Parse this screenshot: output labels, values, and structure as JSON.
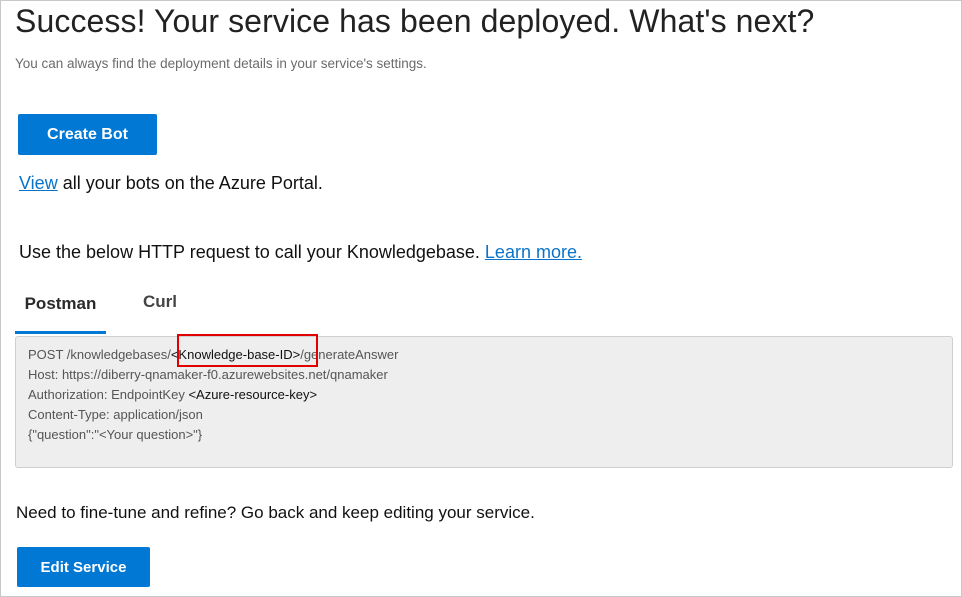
{
  "header": {
    "title": "Success! Your service has been deployed. What's next?",
    "subtitle": "You can always find the deployment details in your service's settings."
  },
  "create_bot": {
    "button_label": "Create Bot",
    "view_link": "View",
    "view_text": " all your bots on the Azure Portal."
  },
  "http_request": {
    "intro_text": "Use the below HTTP request to call your Knowledgebase. ",
    "learn_more_link": "Learn more.",
    "tabs": [
      {
        "label": "Postman",
        "selected": true
      },
      {
        "label": "Curl",
        "selected": false
      }
    ],
    "code": {
      "line1_prefix": "POST /knowledgebases/",
      "line1_placeholder": "<Knowledge-base-ID>",
      "line1_suffix": "/generateAnswer",
      "line2": "Host: https://diberry-qnamaker-f0.azurewebsites.net/qnamaker",
      "line3_prefix": "Authorization: EndpointKey ",
      "line3_placeholder": "<Azure-resource-key>",
      "line4": "Content-Type: application/json",
      "line5": "{\"question\":\"<Your question>\"}"
    },
    "highlight_color": "#e00000"
  },
  "edit": {
    "prompt_text": "Need to fine-tune and refine? Go back and keep editing your service.",
    "button_label": "Edit Service"
  },
  "colors": {
    "primary": "#0078d4",
    "link": "#0a73c9",
    "code_background": "#eeeeee"
  }
}
